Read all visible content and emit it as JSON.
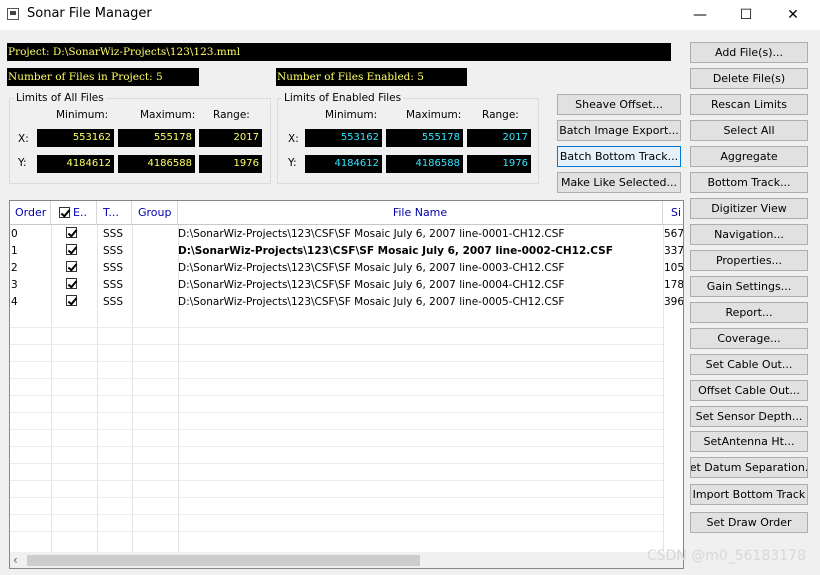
{
  "window": {
    "title": "Sonar File Manager",
    "minimize_glyph": "—",
    "maximize_glyph": "☐",
    "close_glyph": "✕"
  },
  "project_path": "Project: D:\\SonarWiz-Projects\\123\\123.mml",
  "files_in_project": "Number of Files in Project: 5",
  "files_enabled": "Number of Files Enabled: 5",
  "limits_all": {
    "title": "Limits of All Files",
    "min_label": "Minimum:",
    "max_label": "Maximum:",
    "range_label": "Range:",
    "x_label": "X:",
    "y_label": "Y:",
    "x_min": "553162",
    "x_max": "555178",
    "x_range": "2017",
    "y_min": "4184612",
    "y_max": "4186588",
    "y_range": "1976"
  },
  "limits_enabled": {
    "title": "Limits of Enabled Files",
    "min_label": "Minimum:",
    "max_label": "Maximum:",
    "range_label": "Range:",
    "x_label": "X:",
    "y_label": "Y:",
    "x_min": "553162",
    "x_max": "555178",
    "x_range": "2017",
    "y_min": "4184612",
    "y_max": "4186588",
    "y_range": "1976"
  },
  "middle_buttons": [
    "Sheave Offset...",
    "Batch Image Export...",
    "Batch Bottom Track...",
    "Make Like Selected..."
  ],
  "right_buttons": [
    "Add File(s)...",
    "Delete File(s)",
    "Rescan Limits",
    "Select All",
    "Aggregate",
    "Bottom Track...",
    "Digitizer View",
    "Navigation...",
    "Properties...",
    "Gain Settings...",
    "Report...",
    "Coverage...",
    "Set Cable Out...",
    "Offset Cable Out...",
    "Set Sensor Depth...",
    "SetAntenna Ht...",
    "Set Datum Separation...",
    "Import Bottom Track",
    "Set Draw Order"
  ],
  "table": {
    "headers": {
      "order": "Order",
      "enabled": "E..",
      "type": "T...",
      "group": "Group",
      "file": "File Name",
      "size": "Si"
    },
    "rows": [
      {
        "order": "0",
        "type": "SSS",
        "group": "",
        "file": "D:\\SonarWiz-Projects\\123\\CSF\\SF Mosaic July 6, 2007 line-0001-CH12.CSF",
        "size": "567"
      },
      {
        "order": "1",
        "type": "SSS",
        "group": "",
        "file": "D:\\SonarWiz-Projects\\123\\CSF\\SF Mosaic July 6, 2007 line-0002-CH12.CSF",
        "size": "337"
      },
      {
        "order": "2",
        "type": "SSS",
        "group": "",
        "file": "D:\\SonarWiz-Projects\\123\\CSF\\SF Mosaic July 6, 2007 line-0003-CH12.CSF",
        "size": "105"
      },
      {
        "order": "3",
        "type": "SSS",
        "group": "",
        "file": "D:\\SonarWiz-Projects\\123\\CSF\\SF Mosaic July 6, 2007 line-0004-CH12.CSF",
        "size": "178"
      },
      {
        "order": "4",
        "type": "SSS",
        "group": "",
        "file": "D:\\SonarWiz-Projects\\123\\CSF\\SF Mosaic July 6, 2007 line-0005-CH12.CSF",
        "size": "396"
      }
    ]
  },
  "watermark": "CSDN @m0_56183178",
  "colors": {
    "readout_bg": "#000000",
    "readout_text": "#ffff66",
    "enabled_values": "#33e5ff",
    "header_text": "#0000aa",
    "focus_border": "#0078d7"
  },
  "icons": {
    "app": "app-icon",
    "scroll_left": "‹"
  }
}
